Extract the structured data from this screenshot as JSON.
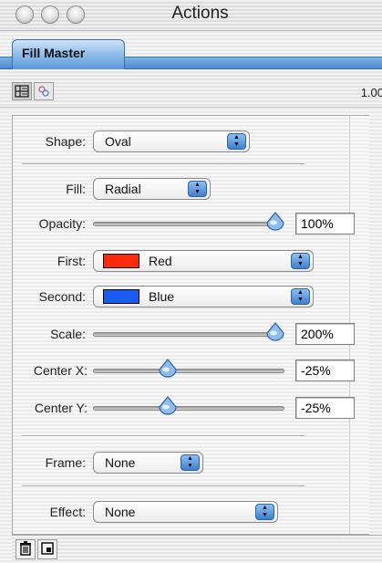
{
  "window": {
    "title": "Actions"
  },
  "tabs": [
    {
      "label": "Fill Master"
    }
  ],
  "toolbar": {
    "zoom": "1.00"
  },
  "panel": {
    "shape": {
      "label": "Shape:",
      "value": "Oval"
    },
    "fill": {
      "label": "Fill:",
      "value": "Radial"
    },
    "opacity": {
      "label": "Opacity:",
      "value": "100%",
      "level": 1.0
    },
    "first": {
      "label": "First:",
      "value": "Red",
      "color": "#ff2a0a"
    },
    "second": {
      "label": "Second:",
      "value": "Blue",
      "color": "#1a5cf0"
    },
    "scale": {
      "label": "Scale:",
      "value": "200%",
      "level": 1.0
    },
    "center_x": {
      "label": "Center X:",
      "value": "-25%",
      "level": 0.375
    },
    "center_y": {
      "label": "Center Y:",
      "value": "-25%",
      "level": 0.375
    },
    "frame": {
      "label": "Frame:",
      "value": "None"
    },
    "effect": {
      "label": "Effect:",
      "value": "None"
    }
  },
  "colors": {
    "accent_blue": "#4d8ad0"
  },
  "icons": {
    "traffic": [
      "close-icon",
      "minimize-icon",
      "zoom-icon"
    ],
    "toolbar": [
      "list-view-icon",
      "effects-icon"
    ],
    "bottom": [
      "trash-icon",
      "new-item-icon"
    ]
  }
}
